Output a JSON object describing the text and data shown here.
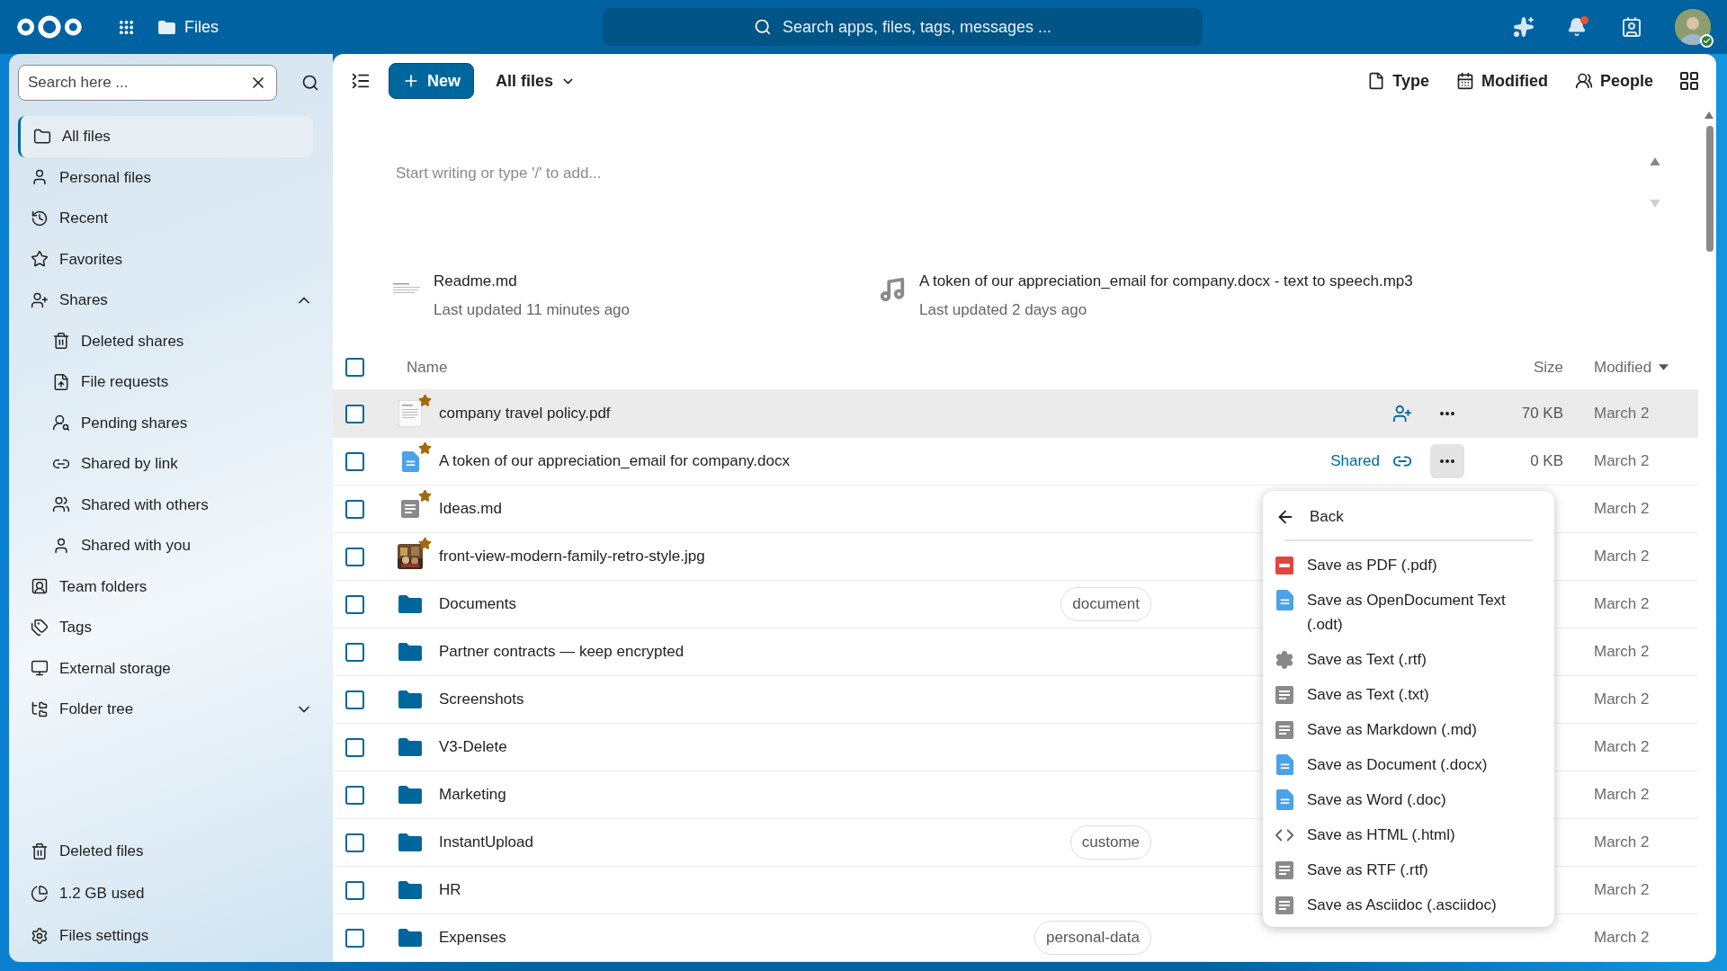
{
  "header": {
    "app_name": "Files",
    "search_placeholder": "Search apps, files, tags, messages ...",
    "notifications_unread": true
  },
  "sidebar": {
    "search_placeholder": "Search here ...",
    "items": [
      {
        "label": "All files",
        "selected": true
      },
      {
        "label": "Personal files",
        "selected": false
      },
      {
        "label": "Recent",
        "selected": false
      },
      {
        "label": "Favorites",
        "selected": false
      },
      {
        "label": "Shares",
        "selected": false,
        "expanded": true,
        "children": [
          {
            "label": "Deleted shares",
            "selected": false
          },
          {
            "label": "File requests",
            "selected": false
          },
          {
            "label": "Pending shares",
            "selected": false
          },
          {
            "label": "Shared by link",
            "selected": false
          },
          {
            "label": "Shared with others",
            "selected": false
          },
          {
            "label": "Shared with you",
            "selected": false
          }
        ]
      },
      {
        "label": "Team folders",
        "selected": false
      },
      {
        "label": "Tags",
        "selected": false
      },
      {
        "label": "External storage",
        "selected": false
      },
      {
        "label": "Folder tree",
        "selected": false,
        "expanded": false
      }
    ],
    "footer": [
      "Deleted files",
      "1.2 GB used",
      "Files settings"
    ]
  },
  "toolbar": {
    "new_button": "New",
    "location": "All files",
    "filters": [
      "Type",
      "Modified",
      "People"
    ]
  },
  "workspace": {
    "placeholder": "Start writing or type '/' to add..."
  },
  "recent": [
    {
      "name": "Readme.md",
      "updated": "Last updated 11 minutes ago",
      "kind": "doc"
    },
    {
      "name": "A token of our appreciation_email for company.docx - text to speech.mp3",
      "updated": "Last updated 2 days ago",
      "kind": "audio"
    }
  ],
  "table": {
    "columns": [
      "Name",
      "Size",
      "Modified"
    ],
    "select_all_checked": false,
    "rows": [
      {
        "name": "company travel policy.pdf",
        "kind": "pdf",
        "favorite": true,
        "checked": false,
        "highlighted": true,
        "menu_open": false,
        "size": "70 KB",
        "modified": "March 2"
      },
      {
        "name": "A token of our appreciation_email for company.docx",
        "kind": "docx",
        "favorite": true,
        "checked": false,
        "highlighted": false,
        "shared_label": "Shared",
        "menu_open": true,
        "size": "0 KB",
        "modified": "March 2"
      },
      {
        "name": "Ideas.md",
        "kind": "md",
        "favorite": true,
        "checked": false,
        "highlighted": false,
        "modified": "March 2"
      },
      {
        "name": "front-view-modern-family-retro-style.jpg",
        "favorite": true,
        "checked": false,
        "highlighted": false,
        "modified": "March 2"
      },
      {
        "name": "Documents",
        "kind": "folder",
        "checked": false,
        "highlighted": false,
        "tags": [
          "document"
        ],
        "modified": "March 2"
      },
      {
        "name": "Partner contracts — keep encrypted",
        "kind": "folder",
        "checked": false,
        "highlighted": false,
        "modified": "March 2"
      },
      {
        "name": "Screenshots",
        "kind": "folder",
        "checked": false,
        "highlighted": false,
        "modified": "March 2"
      },
      {
        "name": "V3-Delete",
        "kind": "folder",
        "checked": false,
        "highlighted": false,
        "modified": "March 2"
      },
      {
        "name": "Marketing",
        "kind": "folder",
        "checked": false,
        "highlighted": false,
        "modified": "March 2"
      },
      {
        "name": "InstantUpload",
        "kind": "folder",
        "checked": false,
        "highlighted": false,
        "tags": [
          "custome"
        ],
        "modified": "March 2"
      },
      {
        "name": "HR",
        "kind": "folder",
        "checked": false,
        "highlighted": false,
        "modified": "March 2"
      },
      {
        "name": "Expenses",
        "kind": "folder",
        "checked": false,
        "highlighted": false,
        "tags": [
          "personal-data"
        ],
        "modified": "March 2"
      }
    ]
  },
  "menu": {
    "back": "Back",
    "items": [
      "Save as PDF (.pdf)",
      "Save as OpenDocument Text (.odt)",
      "Save as Text (.rtf)",
      "Save as Text (.txt)",
      "Save as Markdown (.md)",
      "Save as Document (.docx)",
      "Save as Word (.doc)",
      "Save as HTML (.html)",
      "Save as RTF (.rtf)",
      "Save as Asciidoc (.asciidoc)"
    ]
  }
}
